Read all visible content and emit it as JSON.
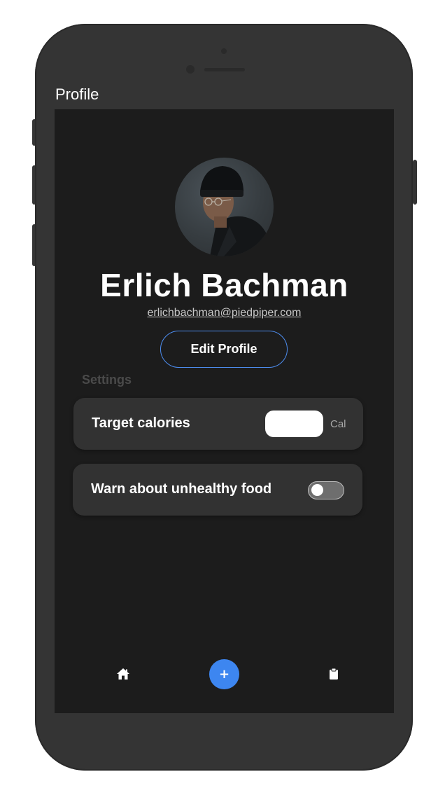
{
  "header": {
    "title": "Profile"
  },
  "profile": {
    "name": "Erlich Bachman",
    "email": "erlichbachman@piedpiper.com",
    "edit_label": "Edit Profile"
  },
  "settings": {
    "section_label": "Settings",
    "target_calories": {
      "label": "Target calories",
      "value": "",
      "unit": "Cal"
    },
    "warn_unhealthy": {
      "label": "Warn about unhealthy food",
      "enabled": false
    }
  },
  "bottom_nav": {
    "items": [
      {
        "icon": "home-icon"
      },
      {
        "icon": "plus-icon",
        "label": "+"
      },
      {
        "icon": "clipboard-icon"
      }
    ]
  },
  "colors": {
    "accent": "#3d86f0",
    "screen_bg": "#1c1c1c",
    "card_bg": "#323232",
    "phone_frame": "#343434"
  }
}
